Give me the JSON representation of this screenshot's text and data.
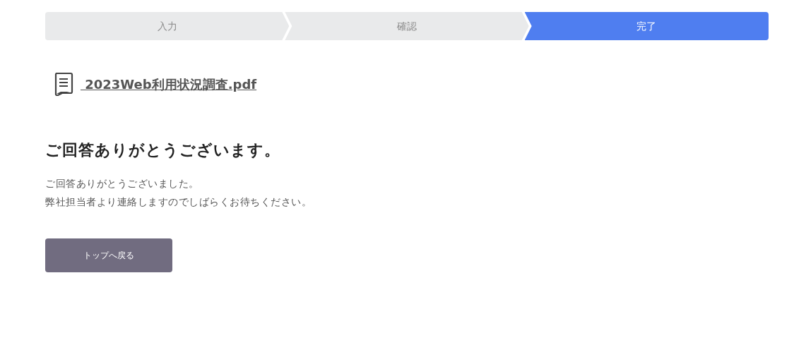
{
  "steps": [
    {
      "label": "入力",
      "selected": false
    },
    {
      "label": "確認",
      "selected": false
    },
    {
      "label": "完了",
      "selected": true
    }
  ],
  "download": {
    "label": " 2023Web利用状況調査.pdf"
  },
  "heading": "ご回答ありがとうございます。",
  "message": [
    "ご回答ありがとうございました。",
    "弊社担当者より連絡しますのでしばらくお待ちください。"
  ],
  "button": "トップへ戻る"
}
